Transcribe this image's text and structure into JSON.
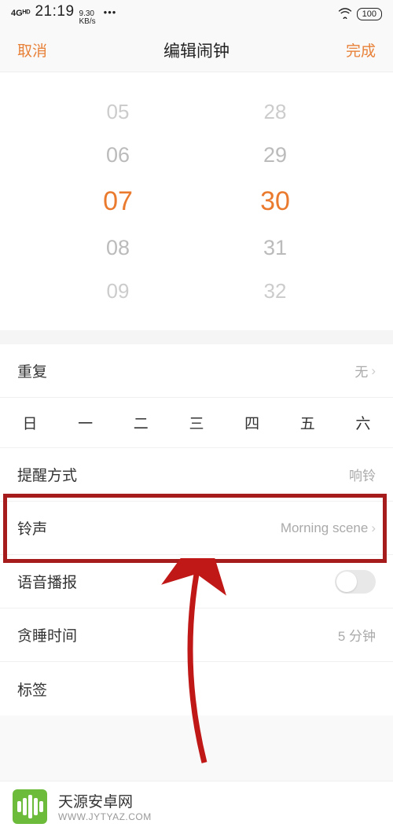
{
  "status": {
    "sig": "4Gᴴᴰ",
    "time": "21:19",
    "kbs_top": "9.30",
    "kbs_bot": "KB/s",
    "dots": "•••",
    "battery": "100"
  },
  "header": {
    "cancel": "取消",
    "title": "编辑闹钟",
    "done": "完成"
  },
  "picker": {
    "hours": [
      "05",
      "06",
      "07",
      "08",
      "09"
    ],
    "mins": [
      "28",
      "29",
      "30",
      "31",
      "32"
    ]
  },
  "rows": {
    "repeat": {
      "label": "重复",
      "value": "无"
    },
    "alert_mode": {
      "label": "提醒方式",
      "value": "响铃"
    },
    "ringtone": {
      "label": "铃声",
      "value": "Morning scene"
    },
    "voice": {
      "label": "语音播报"
    },
    "snooze": {
      "label": "贪睡时间",
      "value": "5 分钟"
    },
    "tag": {
      "label": "标签"
    }
  },
  "weekdays": [
    "日",
    "一",
    "二",
    "三",
    "四",
    "五",
    "六"
  ],
  "watermark": {
    "title": "天源安卓网",
    "sub": "WWW.JYTYAZ.COM"
  }
}
